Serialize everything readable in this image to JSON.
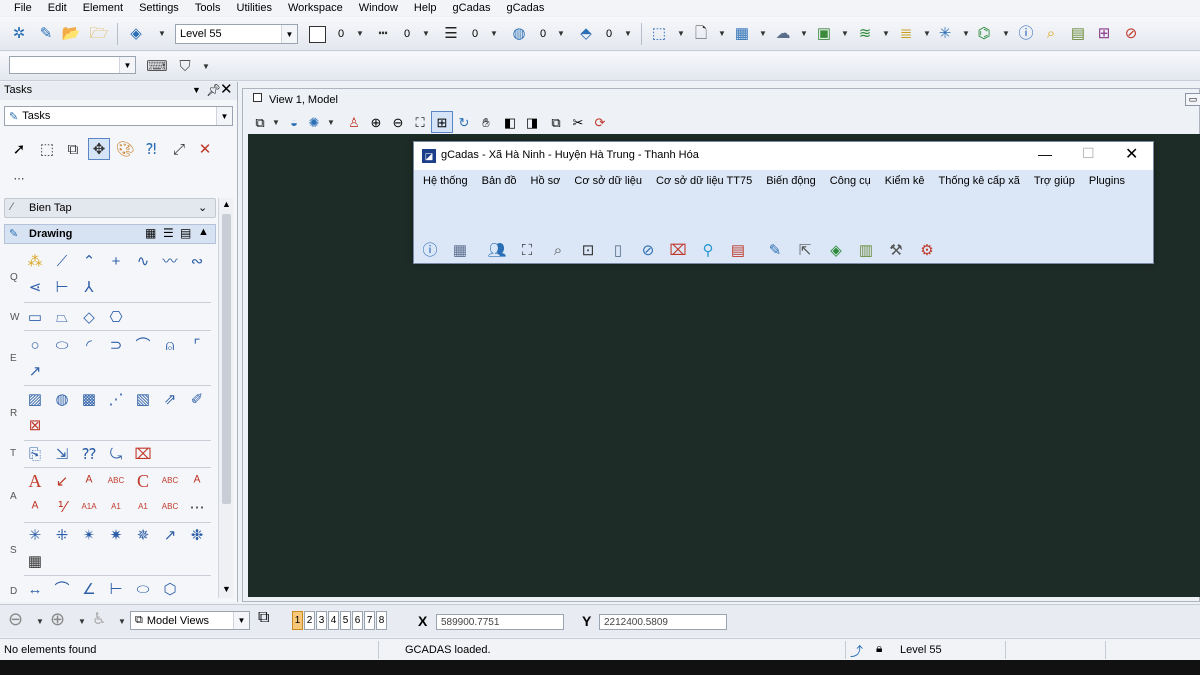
{
  "menubar": {
    "items": [
      "File",
      "Edit",
      "Element",
      "Settings",
      "Tools",
      "Utilities",
      "Workspace",
      "Window",
      "Help",
      "gCadas",
      "gCadas"
    ]
  },
  "toolbar": {
    "level_value": "Level 55",
    "color_value": "0",
    "style_value": "0",
    "weight_value": "0",
    "transparency_value": "0",
    "priority_value": "0"
  },
  "tasks": {
    "header": "Tasks",
    "dropdown_value": "Tasks",
    "section_bien_tap": "Bien Tap",
    "section_drawing": "Drawing",
    "tool_row_labels": [
      "Q",
      "W",
      "E",
      "R",
      "T",
      "A",
      "S",
      "D"
    ]
  },
  "view": {
    "title": "View 1, Model"
  },
  "dialog": {
    "title": "gCadas - Xã Hà Ninh - Huyện Hà Trung - Thanh Hóa",
    "menu": [
      "Hệ thống",
      "Bản đồ",
      "Hồ sơ",
      "Cơ sở dữ liệu",
      "Cơ sở dữ liệu TT75",
      "Biến động",
      "Công cụ",
      "Kiểm kê",
      "Thống kê cấp xã",
      "Trợ giúp",
      "Plugins"
    ]
  },
  "bottom": {
    "model_views": "Model Views",
    "pages": [
      "1",
      "2",
      "3",
      "4",
      "5",
      "6",
      "7",
      "8"
    ],
    "x_label": "X",
    "x_value": "589900.7751",
    "y_label": "Y",
    "y_value": "2212400.5809"
  },
  "status": {
    "left": "No elements found",
    "message": "GCADAS loaded.",
    "level": "Level 55"
  }
}
